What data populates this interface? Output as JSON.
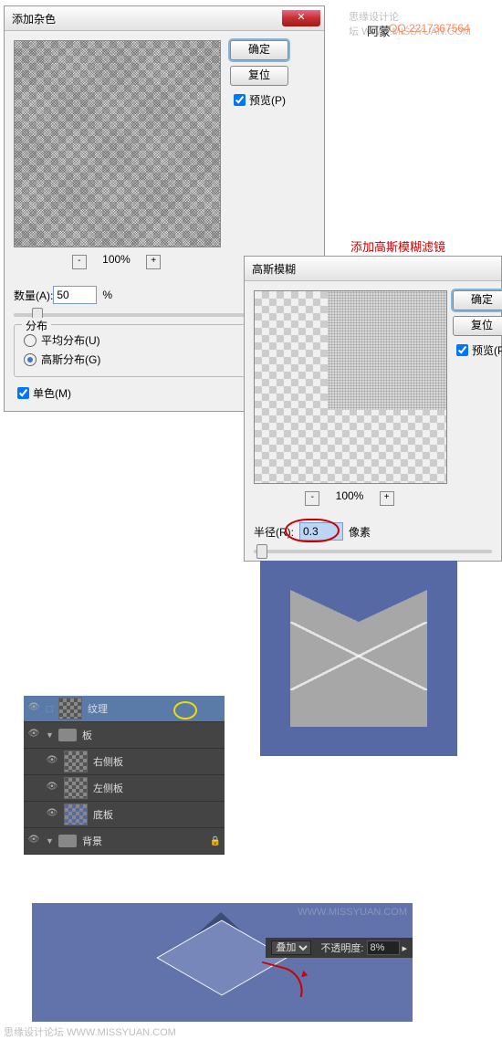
{
  "watermarks": {
    "top": "思缘设计论坛",
    "top_url": "WWW.MISSYUAN.COM",
    "bottom": "思缘设计论坛",
    "bottom_url": "WWW.MISSYUAN.COM",
    "arrow": "WWW.MISSYUAN.COM"
  },
  "credit": {
    "name": "阿蒙",
    "qq": "QQ:2217367564"
  },
  "dialog1": {
    "title": "添加杂色",
    "ok": "确定",
    "reset": "复位",
    "preview": "预览(P)",
    "zoom": "100%",
    "minus": "-",
    "plus": "+",
    "amount_label": "数量(A):",
    "amount_value": "50",
    "pct": "%",
    "group": "分布",
    "radio_uniform": "平均分布(U)",
    "radio_gauss": "高斯分布(G)",
    "mono": "单色(M)"
  },
  "annotation1": "添加高斯模糊滤镜",
  "dialog2": {
    "title": "高斯模糊",
    "ok": "确定",
    "reset": "复位",
    "preview": "预览(P",
    "zoom": "100%",
    "minus": "-",
    "plus": "+",
    "radius_label": "半径(R):",
    "radius_value": "0.3",
    "unit": "像素"
  },
  "layers": {
    "texture": "纹理",
    "board": "板",
    "right": "右侧板",
    "left": "左侧板",
    "bottom": "底板",
    "bg": "背景"
  },
  "opacity": {
    "mode": "叠加",
    "label": "不透明度:",
    "value": "8%",
    "arrow": "▸"
  }
}
